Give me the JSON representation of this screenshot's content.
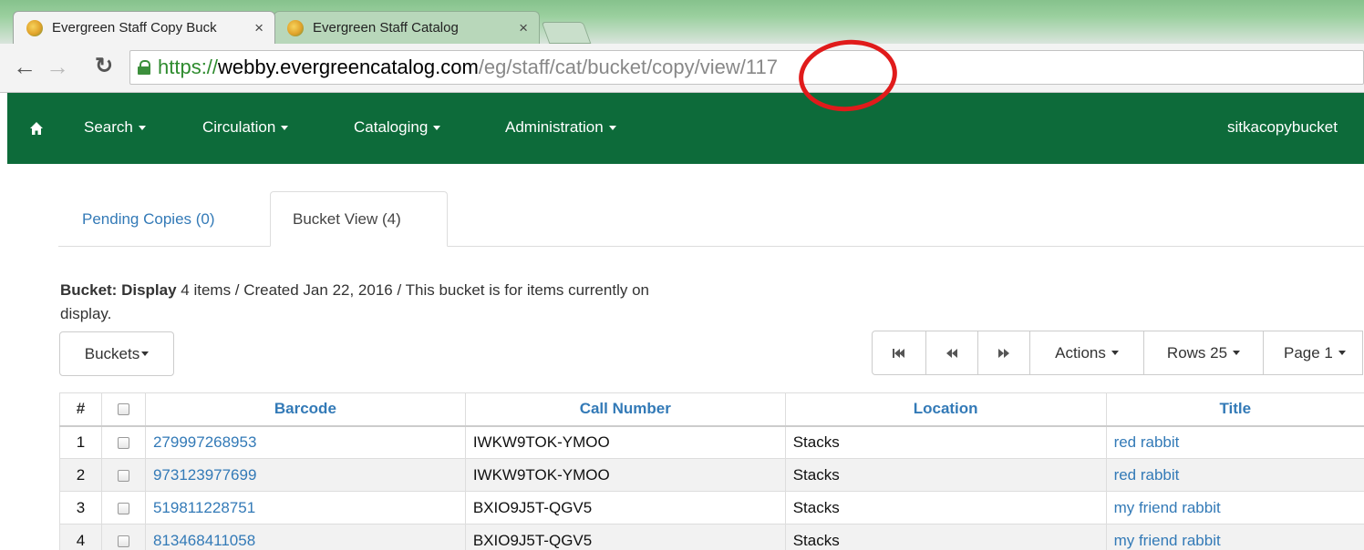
{
  "browser": {
    "tabs": [
      {
        "title": "Evergreen Staff Copy Buck",
        "close": "×"
      },
      {
        "title": "Evergreen Staff Catalog",
        "close": "×"
      }
    ],
    "url": {
      "scheme": "https://",
      "host": "webby.evergreencatalog.com",
      "path": "/eg/staff/cat/bucket/copy/view/117"
    }
  },
  "nav": {
    "items": [
      "Search",
      "Circulation",
      "Cataloging",
      "Administration"
    ],
    "user": "sitkacopybucket"
  },
  "tabs": {
    "pending": "Pending Copies (0)",
    "bucket": "Bucket View (4)"
  },
  "bucket": {
    "label": "Bucket: Display",
    "details": " 4 items / Created Jan 22, 2016 / This bucket is for items currently on display."
  },
  "toolbar": {
    "buckets": "Buckets",
    "actions": "Actions",
    "rows": "Rows 25",
    "page": "Page 1"
  },
  "grid": {
    "headers": [
      "#",
      "",
      "Barcode",
      "Call Number",
      "Location",
      "Title"
    ],
    "rows": [
      {
        "n": "1",
        "barcode": "279997268953",
        "call": "IWKW9TOK-YMOO",
        "location": "Stacks",
        "title": "red rabbit"
      },
      {
        "n": "2",
        "barcode": "973123977699",
        "call": "IWKW9TOK-YMOO",
        "location": "Stacks",
        "title": "red rabbit"
      },
      {
        "n": "3",
        "barcode": "519811228751",
        "call": "BXIO9J5T-QGV5",
        "location": "Stacks",
        "title": "my friend rabbit"
      },
      {
        "n": "4",
        "barcode": "813468411058",
        "call": "BXIO9J5T-QGV5",
        "location": "Stacks",
        "title": "my friend rabbit"
      }
    ]
  },
  "colors": {
    "nav_bg": "#0d6b3a",
    "link": "#337ab7",
    "annotation": "#e01b1b"
  }
}
